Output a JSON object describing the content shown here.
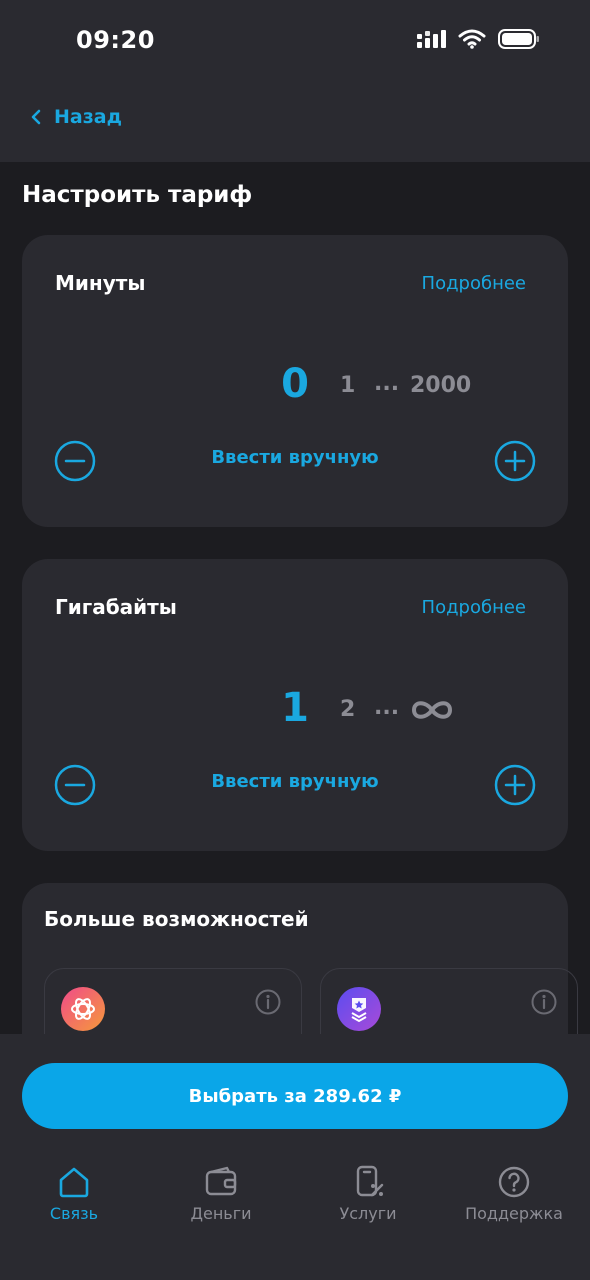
{
  "status_bar": {
    "time": "09:20"
  },
  "nav": {
    "back_label": "Назад"
  },
  "page": {
    "title": "Настроить тариф"
  },
  "minutes": {
    "title": "Минуты",
    "more_label": "Подробнее",
    "selected": "0",
    "next": "1",
    "dots": "...",
    "max": "2000",
    "manual_label": "Ввести вручную"
  },
  "gigabytes": {
    "title": "Гигабайты",
    "more_label": "Подробнее",
    "selected": "1",
    "next": "2",
    "dots": "...",
    "max_icon": "infinity-icon",
    "manual_label": "Ввести вручную"
  },
  "extras": {
    "title": "Больше возможностей",
    "options": [
      {
        "icon": "ai-knot-icon"
      },
      {
        "icon": "star-badge-icon"
      }
    ]
  },
  "select_button": {
    "label": "Выбрать за 289.62 ₽"
  },
  "tabs": [
    {
      "label": "Связь",
      "icon": "home-icon",
      "active": true
    },
    {
      "label": "Деньги",
      "icon": "wallet-icon",
      "active": false
    },
    {
      "label": "Услуги",
      "icon": "services-icon",
      "active": false
    },
    {
      "label": "Поддержка",
      "icon": "help-icon",
      "active": false
    }
  ],
  "colors": {
    "accent": "#1aa8e0",
    "button": "#0aa6e8",
    "background": "#1c1c20",
    "card": "#2a2a30"
  }
}
